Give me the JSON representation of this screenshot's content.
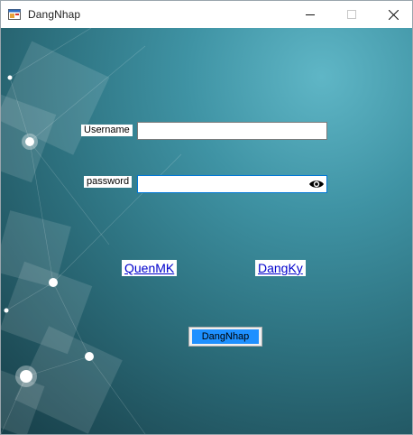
{
  "window": {
    "title": "DangNhap"
  },
  "form": {
    "username_label": "Username",
    "username_value": "",
    "password_label": "password",
    "password_value": "",
    "forgot_link": "QuenMK",
    "register_link": "DangKy",
    "login_button": "DangNhap"
  },
  "icons": {
    "app": "form-app-icon",
    "minimize": "minimize-icon",
    "maximize": "maximize-icon",
    "close": "close-icon",
    "show_password": "eye-icon"
  },
  "colors": {
    "login_button_fill": "#1e90ff",
    "link": "#0000cc",
    "focus_border": "#0078d7"
  }
}
